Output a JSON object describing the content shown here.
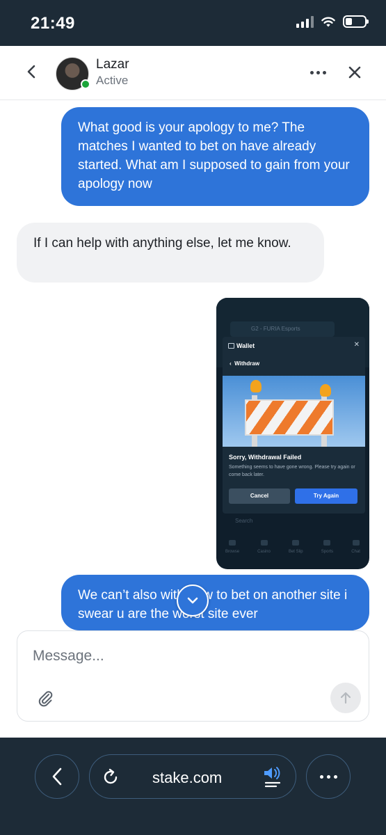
{
  "status_bar": {
    "time": "21:49"
  },
  "header": {
    "contact_name": "Lazar",
    "contact_status": "Active"
  },
  "messages": [
    {
      "direction": "outgoing",
      "text": "What good is your apology to me? The matches I wanted to bet on have already started. What am I supposed to gain from your apology now"
    },
    {
      "direction": "incoming",
      "text": "If I can help with anything else, let me know."
    },
    {
      "direction": "outgoing",
      "type": "image"
    },
    {
      "direction": "outgoing",
      "text": "We can’t also withdraw to bet on another site i swear u are the worst site ever"
    }
  ],
  "screenshot_attachment": {
    "blurred_header": "G2 - FURIA Esports",
    "wallet_title": "Wallet",
    "withdraw_label": "Withdraw",
    "error_title": "Sorry, Withdrawal Failed",
    "error_text": "Something seems to have gone wrong. Please try again or come back later.",
    "cancel_label": "Cancel",
    "try_again_label": "Try Again",
    "search_placeholder": "Search",
    "tabs": [
      "Browse",
      "Casino",
      "Bet Slip",
      "Sports",
      "Chat"
    ]
  },
  "composer": {
    "placeholder": "Message..."
  },
  "browser": {
    "url": "stake.com"
  },
  "colors": {
    "accent": "#2e74d9",
    "dark_bar": "#1d2b37",
    "online": "#1ba53a",
    "incoming_bubble": "#f1f2f4"
  }
}
